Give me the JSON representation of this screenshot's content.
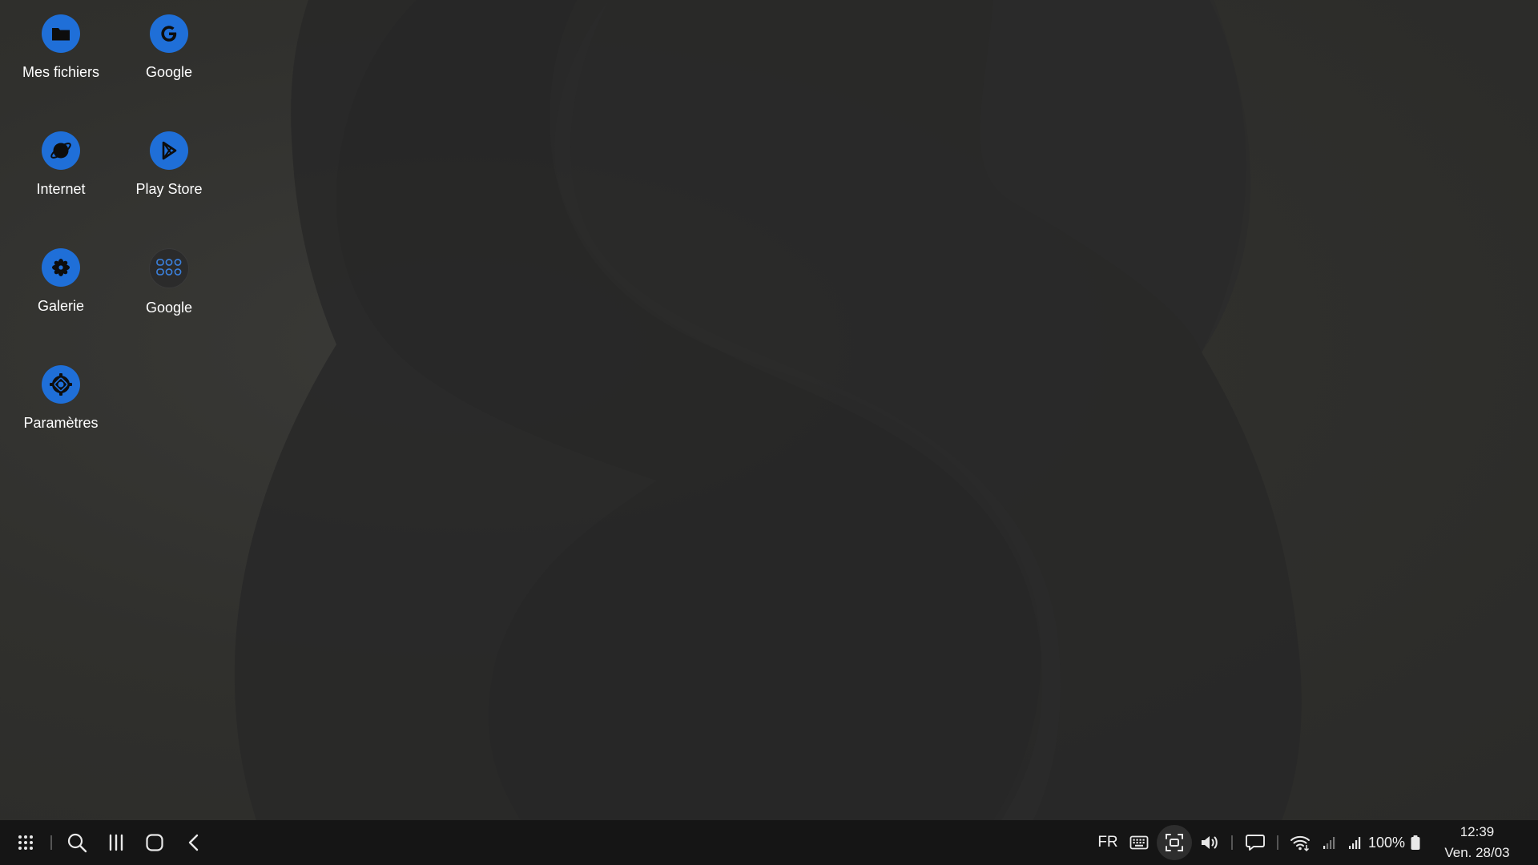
{
  "desktop": {
    "icons": [
      {
        "label": "Mes fichiers",
        "icon": "folder-icon"
      },
      {
        "label": "Google",
        "icon": "google-g-icon"
      },
      {
        "label": "Internet",
        "icon": "internet-globe-icon"
      },
      {
        "label": "Play Store",
        "icon": "play-store-icon"
      },
      {
        "label": "Galerie",
        "icon": "gallery-flower-icon"
      },
      {
        "label": "Google",
        "icon": "google-folder-icon"
      },
      {
        "label": "Paramètres",
        "icon": "settings-gear-icon"
      }
    ]
  },
  "taskbar": {
    "left_icons": [
      "app-drawer-icon",
      "search-icon",
      "recent-apps-icon",
      "home-icon",
      "back-icon"
    ],
    "language": "FR",
    "tray_icons": [
      "keyboard-icon",
      "screen-capture-icon",
      "volume-icon",
      "notification-icon",
      "wifi-icon",
      "signal-1-icon",
      "signal-2-icon",
      "battery-icon"
    ],
    "battery": "100%",
    "time": "12:39",
    "date": "Ven. 28/03"
  },
  "colors": {
    "accent": "#1f6fd8",
    "taskbar_bg": "#151515",
    "desktop_bg": "#30302d"
  }
}
